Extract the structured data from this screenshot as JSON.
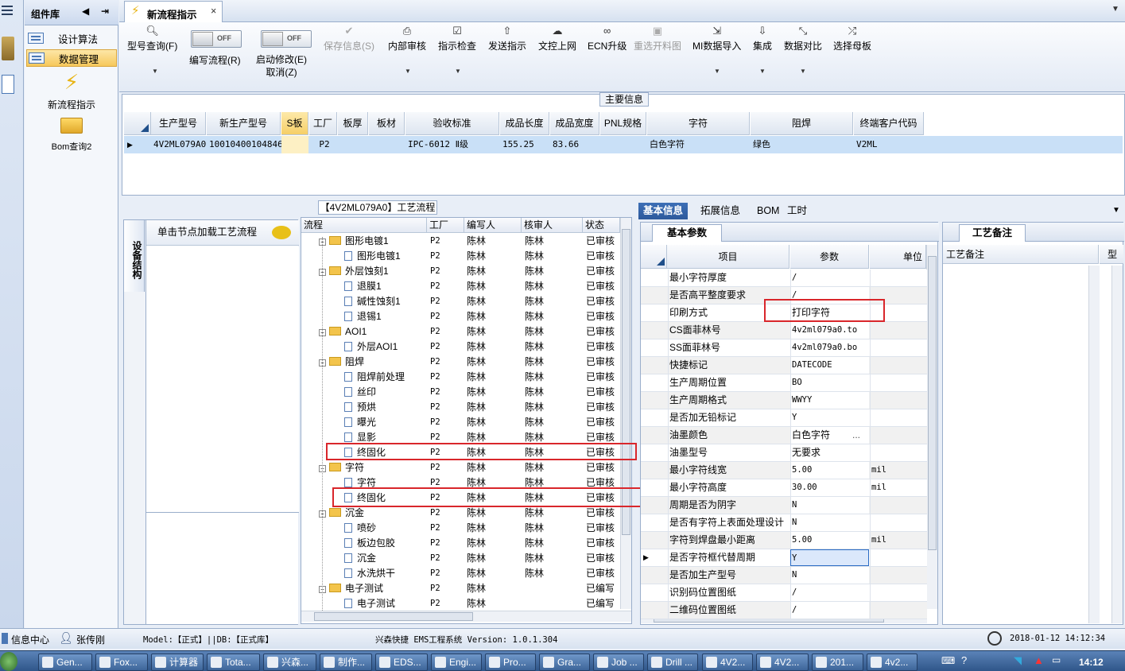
{
  "left_strip": {
    "menu_icon": "hamburger-icon"
  },
  "component_panel": {
    "title": "组件库",
    "items": [
      {
        "label": "设计算法"
      },
      {
        "label": "数据管理"
      }
    ],
    "shortcuts": [
      {
        "label": "新流程指示",
        "icon": "lightning-icon"
      },
      {
        "label": "Bom查询2",
        "icon": "folder-open-icon"
      }
    ]
  },
  "tabs": [
    {
      "label": "新流程指示",
      "close": "×"
    }
  ],
  "toolbar": {
    "buttons": [
      {
        "label": "型号查询(F)",
        "icon": "search-icon"
      },
      {
        "label": "编写流程(R)",
        "toggle": "OFF"
      },
      {
        "label": "启动修改(E)",
        "label2": "取消(Z)",
        "toggle": "OFF"
      },
      {
        "label": "保存信息(S)",
        "icon": "check-icon",
        "disabled": true
      },
      {
        "label": "内部审核",
        "icon": "print-icon"
      },
      {
        "label": "指示检查",
        "icon": "checklist-icon"
      },
      {
        "label": "发送指示",
        "icon": "upload-icon"
      },
      {
        "label": "文控上网",
        "icon": "cloud-upload-icon"
      },
      {
        "label": "ECN升级",
        "icon": "binoculars-icon"
      },
      {
        "label": "重选开料图",
        "icon": "image-icon",
        "disabled": true
      },
      {
        "label": "MI数据导入",
        "icon": "import-icon"
      },
      {
        "label": "集成",
        "icon": "download-icon"
      },
      {
        "label": "数据对比",
        "icon": "compare-icon"
      },
      {
        "label": "选择母板",
        "icon": "shuffle-icon"
      }
    ]
  },
  "main_info": {
    "legend": "主要信息",
    "columns": [
      "生产型号",
      "新生产型号",
      "S板",
      "工厂",
      "板厚",
      "板材",
      "验收标准",
      "成品长度",
      "成品宽度",
      "PNL规格",
      "字符",
      "阻焊",
      "终端客户代码"
    ],
    "row": [
      "4V2ML079A0",
      "10010400104846",
      "",
      "P2",
      "",
      "",
      "IPC-6012 Ⅱ级",
      "155.25",
      "83.66",
      "",
      "白色字符",
      "绿色",
      "V2ML"
    ]
  },
  "device_panel": {
    "tab": "设备结构",
    "hint": "单击节点加载工艺流程"
  },
  "flow": {
    "title": "【4V2ML079A0】工艺流程",
    "columns": [
      "流程",
      "工厂",
      "编写人",
      "核审人",
      "状态"
    ],
    "rows": [
      {
        "level": 0,
        "name": "图形电镀1",
        "factory": "P2",
        "writer": "陈林",
        "reviewer": "陈林",
        "status": "已审核"
      },
      {
        "level": 1,
        "name": "图形电镀1",
        "factory": "P2",
        "writer": "陈林",
        "reviewer": "陈林",
        "status": "已审核"
      },
      {
        "level": 0,
        "name": "外层蚀刻1",
        "factory": "P2",
        "writer": "陈林",
        "reviewer": "陈林",
        "status": "已审核"
      },
      {
        "level": 1,
        "name": "退膜1",
        "factory": "P2",
        "writer": "陈林",
        "reviewer": "陈林",
        "status": "已审核"
      },
      {
        "level": 1,
        "name": "碱性蚀刻1",
        "factory": "P2",
        "writer": "陈林",
        "reviewer": "陈林",
        "status": "已审核"
      },
      {
        "level": 1,
        "name": "退锡1",
        "factory": "P2",
        "writer": "陈林",
        "reviewer": "陈林",
        "status": "已审核"
      },
      {
        "level": 0,
        "name": "AOI1",
        "factory": "P2",
        "writer": "陈林",
        "reviewer": "陈林",
        "status": "已审核"
      },
      {
        "level": 1,
        "name": "外层AOI1",
        "factory": "P2",
        "writer": "陈林",
        "reviewer": "陈林",
        "status": "已审核"
      },
      {
        "level": 0,
        "name": "阻焊",
        "factory": "P2",
        "writer": "陈林",
        "reviewer": "陈林",
        "status": "已审核"
      },
      {
        "level": 1,
        "name": "阻焊前处理",
        "factory": "P2",
        "writer": "陈林",
        "reviewer": "陈林",
        "status": "已审核"
      },
      {
        "level": 1,
        "name": "丝印",
        "factory": "P2",
        "writer": "陈林",
        "reviewer": "陈林",
        "status": "已审核"
      },
      {
        "level": 1,
        "name": "预烘",
        "factory": "P2",
        "writer": "陈林",
        "reviewer": "陈林",
        "status": "已审核"
      },
      {
        "level": 1,
        "name": "曝光",
        "factory": "P2",
        "writer": "陈林",
        "reviewer": "陈林",
        "status": "已审核"
      },
      {
        "level": 1,
        "name": "显影",
        "factory": "P2",
        "writer": "陈林",
        "reviewer": "陈林",
        "status": "已审核"
      },
      {
        "level": 1,
        "name": "终固化",
        "factory": "P2",
        "writer": "陈林",
        "reviewer": "陈林",
        "status": "已审核"
      },
      {
        "level": 0,
        "name": "字符",
        "factory": "P2",
        "writer": "陈林",
        "reviewer": "陈林",
        "status": "已审核"
      },
      {
        "level": 1,
        "name": "字符",
        "factory": "P2",
        "writer": "陈林",
        "reviewer": "陈林",
        "status": "已审核"
      },
      {
        "level": 1,
        "name": "终固化",
        "factory": "P2",
        "writer": "陈林",
        "reviewer": "陈林",
        "status": "已审核"
      },
      {
        "level": 0,
        "name": "沉金",
        "factory": "P2",
        "writer": "陈林",
        "reviewer": "陈林",
        "status": "已审核"
      },
      {
        "level": 1,
        "name": "喷砂",
        "factory": "P2",
        "writer": "陈林",
        "reviewer": "陈林",
        "status": "已审核"
      },
      {
        "level": 1,
        "name": "板边包胶",
        "factory": "P2",
        "writer": "陈林",
        "reviewer": "陈林",
        "status": "已审核"
      },
      {
        "level": 1,
        "name": "沉金",
        "factory": "P2",
        "writer": "陈林",
        "reviewer": "陈林",
        "status": "已审核"
      },
      {
        "level": 1,
        "name": "水洗烘干",
        "factory": "P2",
        "writer": "陈林",
        "reviewer": "陈林",
        "status": "已审核"
      },
      {
        "level": 0,
        "name": "电子测试",
        "factory": "P2",
        "writer": "陈林",
        "reviewer": "",
        "status": "已编写"
      },
      {
        "level": 1,
        "name": "电子测试",
        "factory": "P2",
        "writer": "陈林",
        "reviewer": "",
        "status": "已编写"
      }
    ]
  },
  "right_tabs": [
    "基本信息",
    "拓展信息",
    "BOM",
    "工时"
  ],
  "basic_params": {
    "tab": "基本参数",
    "columns": [
      "项目",
      "参数",
      "单位"
    ],
    "rows": [
      {
        "item": "最小字符厚度",
        "value": "/",
        "unit": ""
      },
      {
        "item": "是否高平整度要求",
        "value": "/",
        "unit": ""
      },
      {
        "item": "印刷方式",
        "value": "打印字符",
        "unit": ""
      },
      {
        "item": "CS面菲林号",
        "value": "4v2ml079a0.to",
        "unit": ""
      },
      {
        "item": "SS面菲林号",
        "value": "4v2ml079a0.bo",
        "unit": ""
      },
      {
        "item": "快捷标记",
        "value": "DATECODE",
        "unit": ""
      },
      {
        "item": "生产周期位置",
        "value": "BO",
        "unit": ""
      },
      {
        "item": "生产周期格式",
        "value": "WWYY",
        "unit": ""
      },
      {
        "item": "是否加无铅标记",
        "value": "Y",
        "unit": ""
      },
      {
        "item": "油墨颜色",
        "value": "白色字符",
        "unit": "",
        "ellipsis": "..."
      },
      {
        "item": "油墨型号",
        "value": "无要求",
        "unit": ""
      },
      {
        "item": "最小字符线宽",
        "value": "5.00",
        "unit": "mil"
      },
      {
        "item": "最小字符高度",
        "value": "30.00",
        "unit": "mil"
      },
      {
        "item": "周期是否为阴字",
        "value": "N",
        "unit": ""
      },
      {
        "item": "是否有字符上表面处理设计",
        "value": "N",
        "unit": ""
      },
      {
        "item": "字符到焊盘最小距离",
        "value": "5.00",
        "unit": "mil"
      },
      {
        "item": "是否字符框代替周期",
        "value": "Y",
        "unit": ""
      },
      {
        "item": "是否加生产型号",
        "value": "N",
        "unit": ""
      },
      {
        "item": "识别码位置图纸",
        "value": "/",
        "unit": ""
      },
      {
        "item": "二维码位置图纸",
        "value": "/",
        "unit": ""
      }
    ]
  },
  "notes": {
    "tab": "工艺备注",
    "col1": "工艺备注",
    "col2": "型"
  },
  "statusbar": {
    "info_center": "信息中心",
    "user": "张传刚",
    "model_db": "Model:【正式】||DB:【正式库】",
    "app": "兴森快捷 EMS工程系统 Version: 1.0.1.304",
    "datetime": "2018-01-12 14:12:34"
  },
  "taskbar": {
    "buttons": [
      "Gen...",
      "Fox...",
      "计算器",
      "Tota...",
      "兴森...",
      "制作...",
      "EDS...",
      "Engi...",
      "Pro...",
      "Gra...",
      "Job ...",
      "Drill ...",
      "4V2...",
      "4V2...",
      "201...",
      "4v2..."
    ],
    "clock": "14:12"
  }
}
